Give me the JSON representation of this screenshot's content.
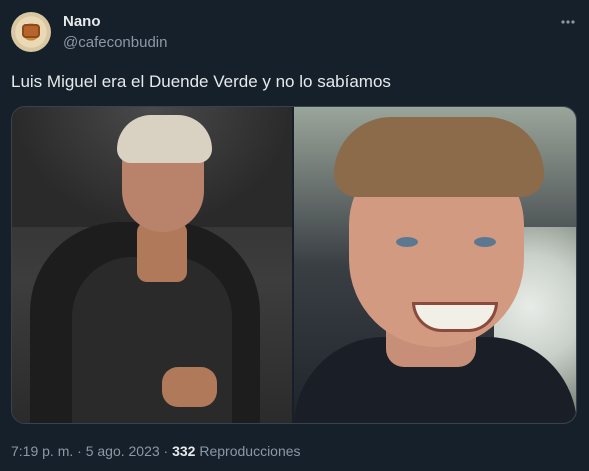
{
  "tweet": {
    "author_name": "Nano",
    "author_handle": "@cafeconbudin",
    "text": "Luis Miguel era el Duende Verde y no lo sabíamos",
    "timestamp": "7:19 p. m. · 5 ago. 2023",
    "separator": " · ",
    "views_count": "332",
    "views_label": "Reproducciones"
  },
  "icons": {
    "more": "more-options-icon",
    "avatar": "avatar-image"
  },
  "colors": {
    "background": "#15202b",
    "primary_text": "#e7e9ea",
    "secondary_text": "#8b98a5",
    "border": "#38444d"
  }
}
